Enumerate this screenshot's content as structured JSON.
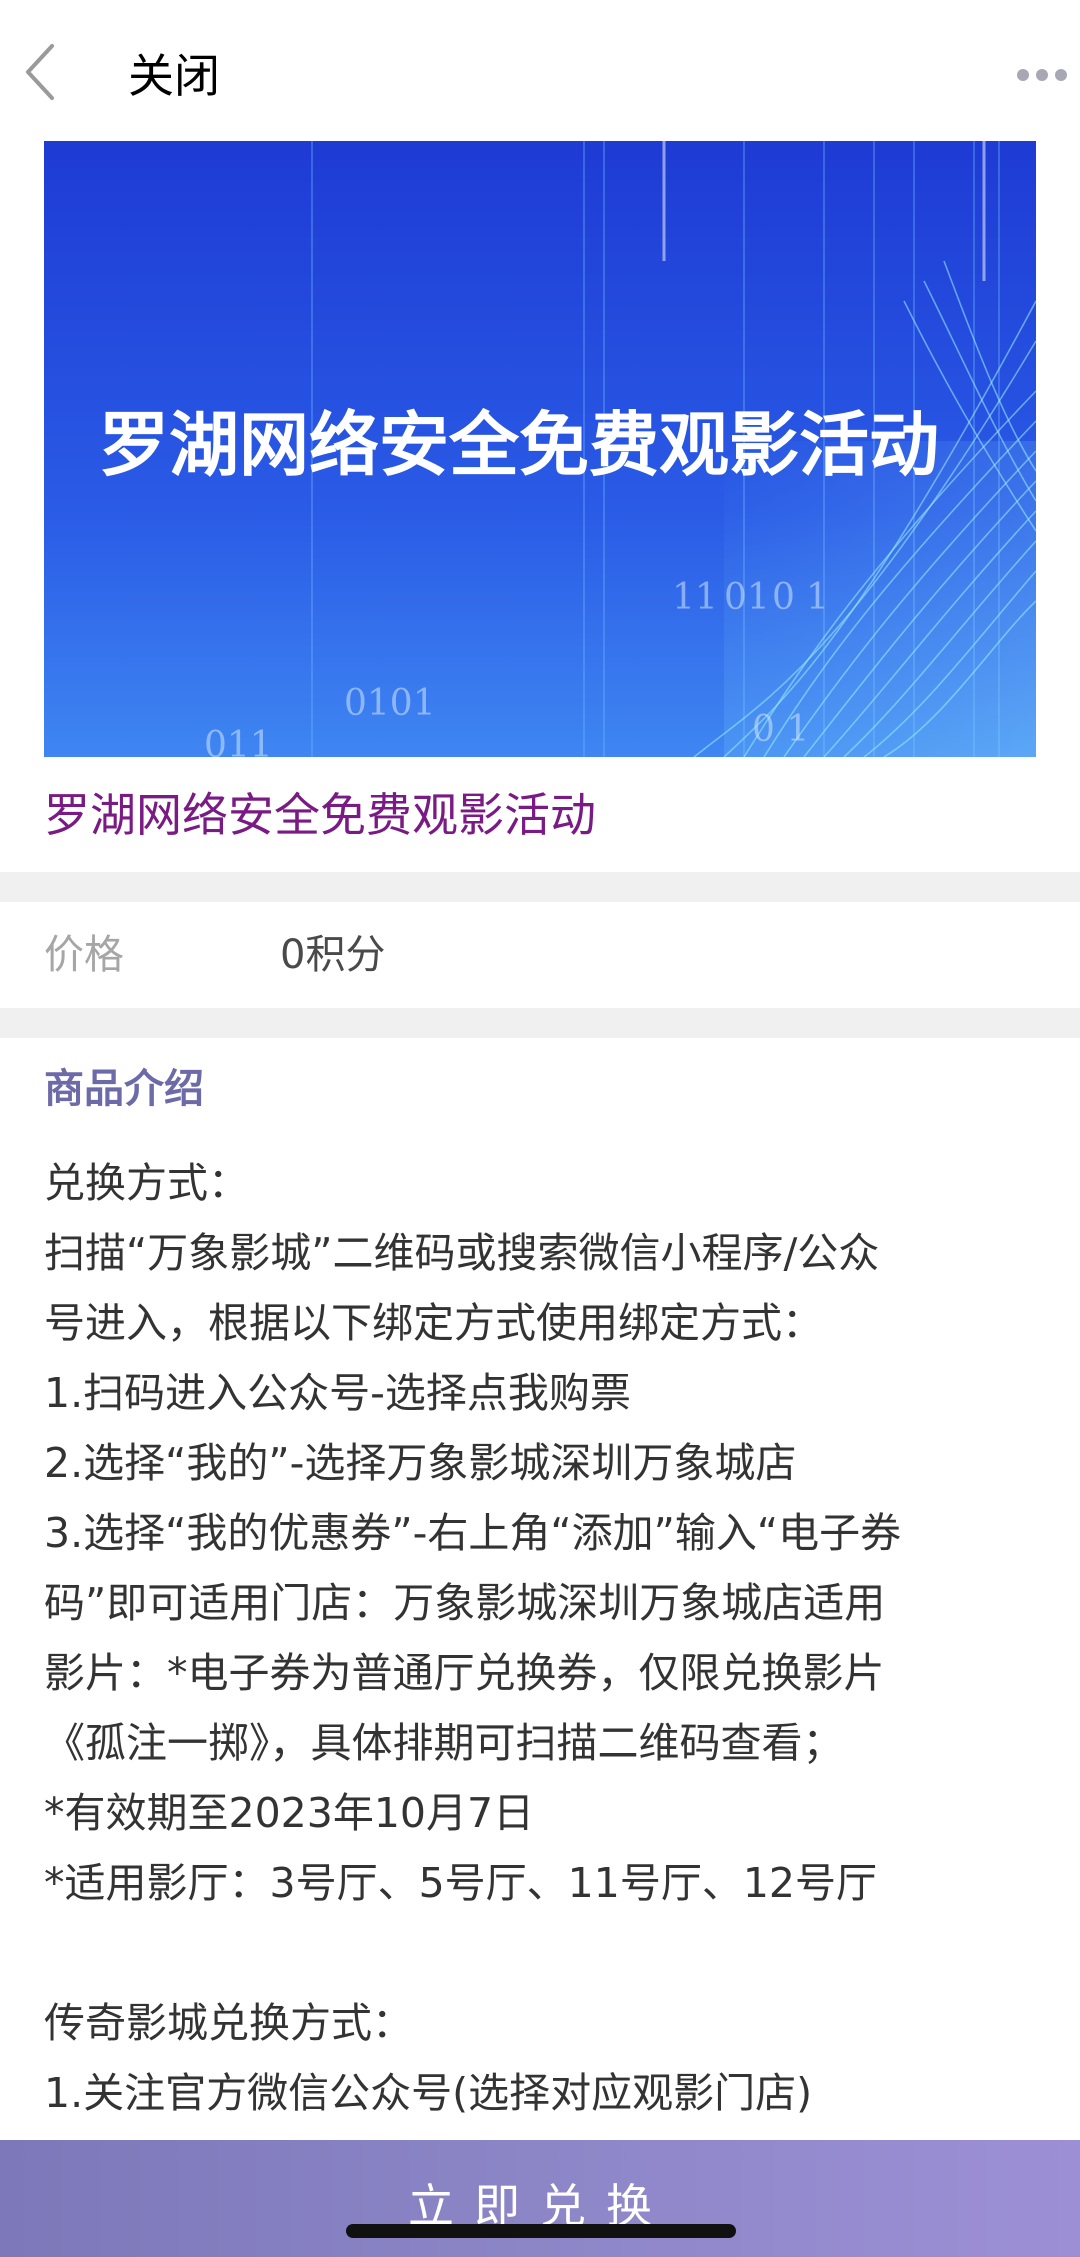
{
  "nav": {
    "close_label": "关闭",
    "back_icon": "chevron-left-icon",
    "more_icon": "more-horizontal-icon"
  },
  "banner": {
    "headline": "罗湖网络安全免费观影活动",
    "decor_text": [
      "11",
      "01",
      "0",
      "1",
      "0101",
      "011",
      "0 1"
    ],
    "colors": {
      "top": "#1f3fd6",
      "bottom": "#3a7ef0",
      "accent": "#8ee6ff"
    }
  },
  "product": {
    "title": "罗湖网络安全免费观影活动"
  },
  "price": {
    "label": "价格",
    "value": "0积分"
  },
  "intro": {
    "title": "商品介绍",
    "lines": [
      "兑换方式：",
      "扫描“万象影城”二维码或搜索微信小程序/公众",
      "号进入，根据以下绑定方式使用绑定方式：",
      "1.扫码进入公众号-选择点我购票",
      "2.选择“我的”-选择万象影城深圳万象城店",
      "3.选择“我的优惠券”-右上角“添加”输入“电子券",
      "码”即可适用门店：万象影城深圳万象城店适用",
      "影片：*电子券为普通厅兑换券，仅限兑换影片",
      "《孤注一掷》，具体排期可扫描二维码查看；",
      "*有效期至2023年10月7日",
      "*适用影厅：3号厅、5号厅、11号厅、12号厅",
      "",
      "传奇影城兑换方式：",
      "1.关注官方微信公众号(选择对应观影门店)"
    ]
  },
  "action": {
    "redeem_label": "立即兑换"
  },
  "colors": {
    "title_purple": "#7a1a84",
    "section_title": "#6d6aa8",
    "button_gradient_start": "#7c78b9",
    "button_gradient_end": "#9d8fd6"
  }
}
